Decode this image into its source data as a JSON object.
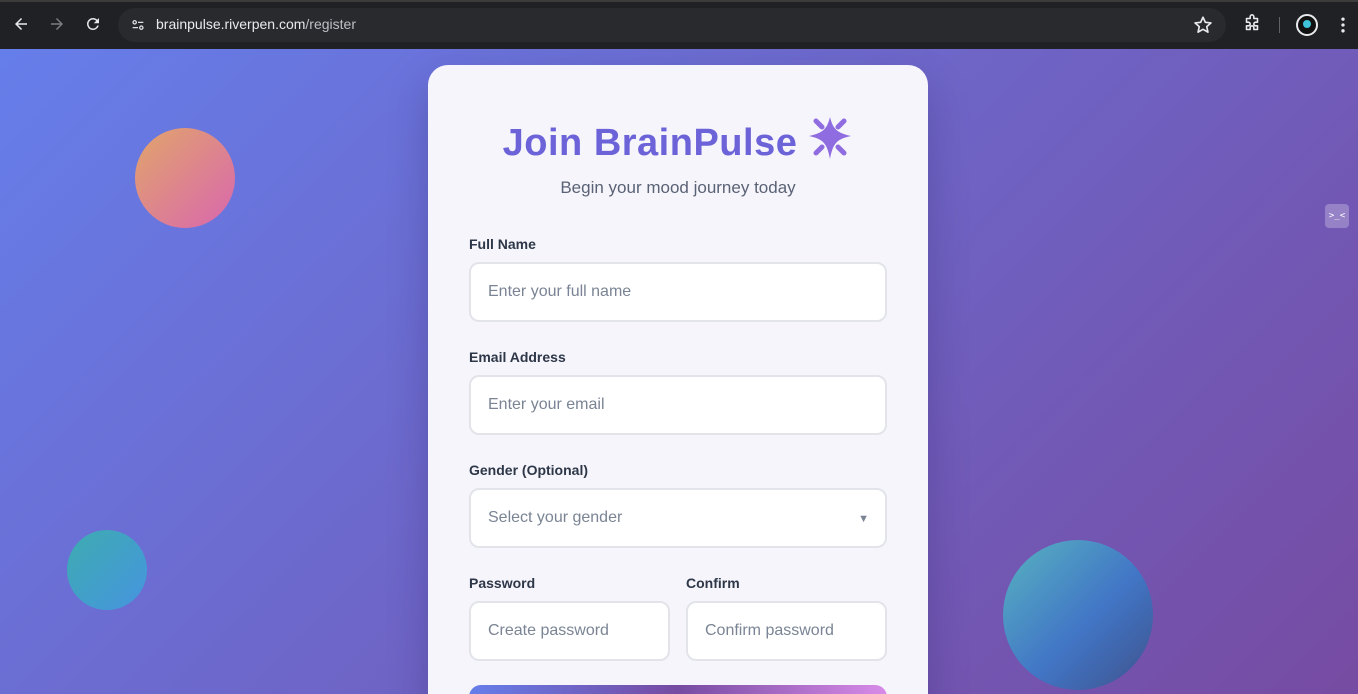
{
  "browser": {
    "url_host": "brainpulse.riverpen.com",
    "url_path": "/register"
  },
  "side_tab": {
    "text": ">_<"
  },
  "form": {
    "title": "Join BrainPulse",
    "subtitle": "Begin your mood journey today",
    "full_name": {
      "label": "Full Name",
      "placeholder": "Enter your full name"
    },
    "email": {
      "label": "Email Address",
      "placeholder": "Enter your email"
    },
    "gender": {
      "label": "Gender (Optional)",
      "placeholder": "Select your gender"
    },
    "password": {
      "label": "Password",
      "placeholder": "Create password"
    },
    "confirm": {
      "label": "Confirm",
      "placeholder": "Confirm password"
    }
  },
  "colors": {
    "accent": "#6c63d9",
    "background_start": "#667eea",
    "background_end": "#764ba2"
  }
}
